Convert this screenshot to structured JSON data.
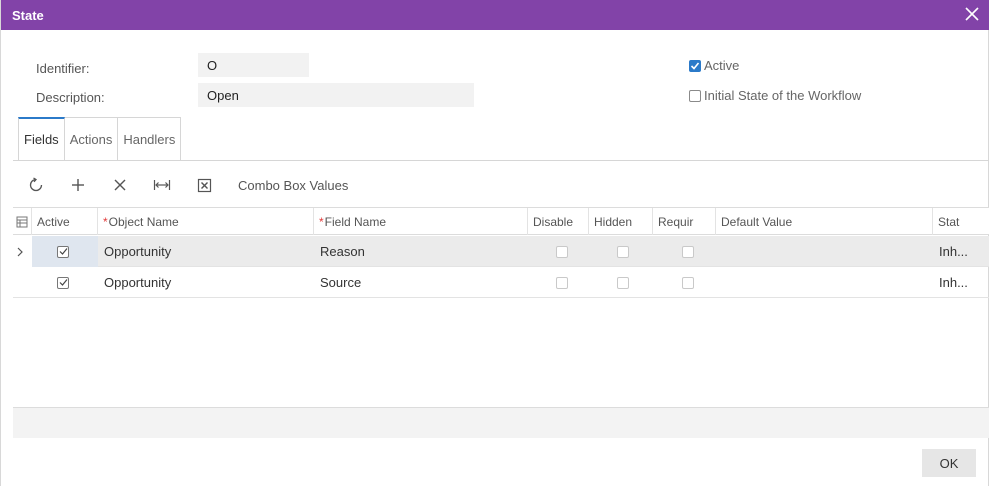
{
  "dialog": {
    "title": "State"
  },
  "form": {
    "identifier_label": "Identifier:",
    "identifier_value": "O",
    "description_label": "Description:",
    "description_value": "Open",
    "active_label": "Active",
    "active_checked": true,
    "initial_state_label": "Initial State of the Workflow",
    "initial_state_checked": false
  },
  "tabs": [
    {
      "label": "Fields",
      "active": true
    },
    {
      "label": "Actions",
      "active": false
    },
    {
      "label": "Handlers",
      "active": false
    }
  ],
  "toolbar": {
    "refresh_icon": "refresh-icon",
    "add_icon": "plus-icon",
    "delete_icon": "x-icon",
    "fit_icon": "fit-columns-icon",
    "export_icon": "excel-export-icon",
    "combo_label": "Combo Box Values"
  },
  "grid": {
    "columns": {
      "active": "Active",
      "object_name": "Object Name",
      "field_name": "Field Name",
      "disabled": "Disable",
      "hidden": "Hidden",
      "required": "Requir",
      "default_value": "Default Value",
      "status": "Stat"
    },
    "rows": [
      {
        "active": true,
        "object_name": "Opportunity",
        "field_name": "Reason",
        "disabled": false,
        "hidden": false,
        "required": false,
        "default_value": "",
        "status": "Inh..."
      },
      {
        "active": true,
        "object_name": "Opportunity",
        "field_name": "Source",
        "disabled": false,
        "hidden": false,
        "required": false,
        "default_value": "",
        "status": "Inh..."
      }
    ]
  },
  "footer": {
    "ok_label": "OK"
  },
  "colors": {
    "titlebar": "#8243a8",
    "accent": "#2b7ac9",
    "required": "#e23b3b"
  }
}
